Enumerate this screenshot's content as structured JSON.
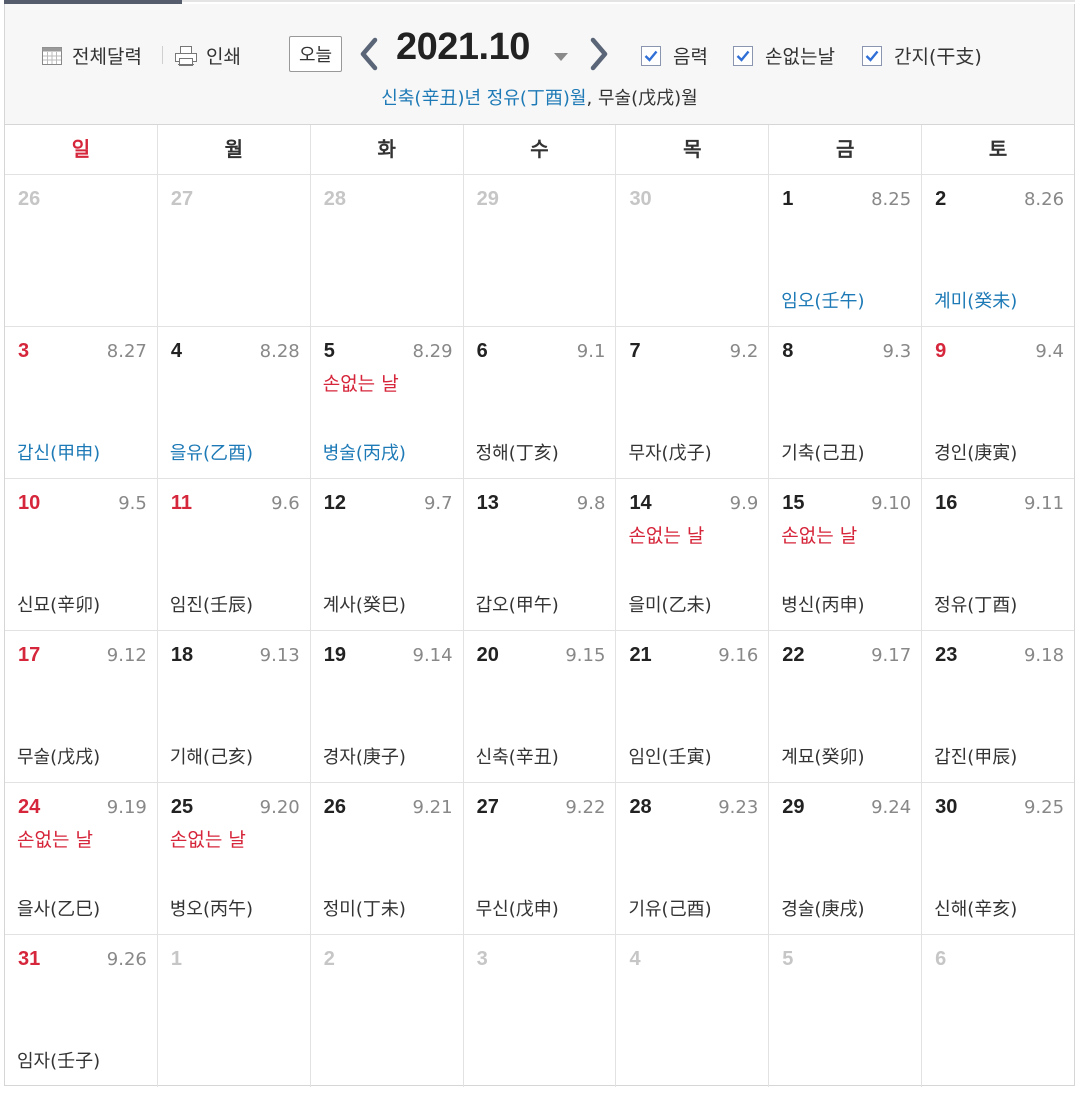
{
  "toolbar": {
    "full_calendar": "전체달력",
    "print": "인쇄",
    "today": "오늘",
    "month_title": "2021.10",
    "opt_lunar": "음력",
    "opt_son": "손없는날",
    "opt_ganji": "간지(干支)"
  },
  "ganji_info": {
    "year": "신축(辛丑)년",
    "month_lunar": "정유(丁酉)월",
    "sep": ", ",
    "month_solar": "무술(戊戌)월"
  },
  "weekdays": [
    "일",
    "월",
    "화",
    "수",
    "목",
    "금",
    "토"
  ],
  "weeks": [
    [
      {
        "day": "26",
        "other": true
      },
      {
        "day": "27",
        "other": true
      },
      {
        "day": "28",
        "other": true
      },
      {
        "day": "29",
        "other": true
      },
      {
        "day": "30",
        "other": true
      },
      {
        "day": "1",
        "lunar": "8.25",
        "ganji": "임오(壬午)",
        "gj_blue": true
      },
      {
        "day": "2",
        "lunar": "8.26",
        "ganji": "계미(癸未)",
        "gj_blue": true
      }
    ],
    [
      {
        "day": "3",
        "lunar": "8.27",
        "ganji": "갑신(甲申)",
        "gj_blue": true
      },
      {
        "day": "4",
        "lunar": "8.28",
        "ganji": "을유(乙酉)",
        "gj_blue": true
      },
      {
        "day": "5",
        "lunar": "8.29",
        "son": "손없는 날",
        "ganji": "병술(丙戌)",
        "gj_blue": true
      },
      {
        "day": "6",
        "lunar": "9.1",
        "ganji": "정해(丁亥)"
      },
      {
        "day": "7",
        "lunar": "9.2",
        "ganji": "무자(戊子)"
      },
      {
        "day": "8",
        "lunar": "9.3",
        "ganji": "기축(己丑)"
      },
      {
        "day": "9",
        "lunar": "9.4",
        "ganji": "경인(庚寅)",
        "red": true
      }
    ],
    [
      {
        "day": "10",
        "lunar": "9.5",
        "ganji": "신묘(辛卯)"
      },
      {
        "day": "11",
        "lunar": "9.6",
        "ganji": "임진(壬辰)",
        "red": true
      },
      {
        "day": "12",
        "lunar": "9.7",
        "ganji": "계사(癸巳)"
      },
      {
        "day": "13",
        "lunar": "9.8",
        "ganji": "갑오(甲午)"
      },
      {
        "day": "14",
        "lunar": "9.9",
        "son": "손없는 날",
        "ganji": "을미(乙未)"
      },
      {
        "day": "15",
        "lunar": "9.10",
        "son": "손없는 날",
        "ganji": "병신(丙申)"
      },
      {
        "day": "16",
        "lunar": "9.11",
        "ganji": "정유(丁酉)"
      }
    ],
    [
      {
        "day": "17",
        "lunar": "9.12",
        "ganji": "무술(戊戌)"
      },
      {
        "day": "18",
        "lunar": "9.13",
        "ganji": "기해(己亥)"
      },
      {
        "day": "19",
        "lunar": "9.14",
        "ganji": "경자(庚子)"
      },
      {
        "day": "20",
        "lunar": "9.15",
        "ganji": "신축(辛丑)"
      },
      {
        "day": "21",
        "lunar": "9.16",
        "ganji": "임인(壬寅)"
      },
      {
        "day": "22",
        "lunar": "9.17",
        "ganji": "계묘(癸卯)"
      },
      {
        "day": "23",
        "lunar": "9.18",
        "ganji": "갑진(甲辰)"
      }
    ],
    [
      {
        "day": "24",
        "lunar": "9.19",
        "son": "손없는 날",
        "ganji": "을사(乙巳)"
      },
      {
        "day": "25",
        "lunar": "9.20",
        "son": "손없는 날",
        "ganji": "병오(丙午)"
      },
      {
        "day": "26",
        "lunar": "9.21",
        "ganji": "정미(丁未)"
      },
      {
        "day": "27",
        "lunar": "9.22",
        "ganji": "무신(戊申)"
      },
      {
        "day": "28",
        "lunar": "9.23",
        "ganji": "기유(己酉)"
      },
      {
        "day": "29",
        "lunar": "9.24",
        "ganji": "경술(庚戌)"
      },
      {
        "day": "30",
        "lunar": "9.25",
        "ganji": "신해(辛亥)"
      }
    ],
    [
      {
        "day": "31",
        "lunar": "9.26",
        "ganji": "임자(壬子)"
      },
      {
        "day": "1",
        "other": true
      },
      {
        "day": "2",
        "other": true
      },
      {
        "day": "3",
        "other": true
      },
      {
        "day": "4",
        "other": true
      },
      {
        "day": "5",
        "other": true
      },
      {
        "day": "6",
        "other": true
      }
    ]
  ],
  "colors": {
    "sunday_red": "#d6263b",
    "ganji_blue": "#1d7ab6",
    "check_blue": "#2f6fd6",
    "arrow_gray": "#5a6578"
  },
  "icons": [
    "calendar-grid-icon",
    "printer-icon",
    "chevron-left-icon",
    "chevron-right-icon",
    "caret-down-icon",
    "checkbox-checked-icon"
  ]
}
